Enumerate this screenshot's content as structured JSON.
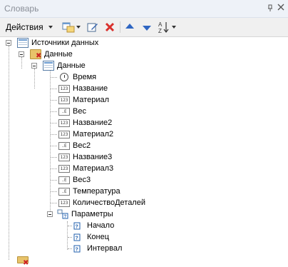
{
  "window": {
    "title": "Словарь",
    "pin_glyph": "ᵖ",
    "close_glyph": "✕"
  },
  "toolbar": {
    "actions_label": "Действия",
    "sort_glyph": "A↓Z"
  },
  "tree": {
    "root": "Источники данных",
    "datasource": "Данные",
    "table": "Данные",
    "fields": [
      {
        "label": "Время",
        "type": "time"
      },
      {
        "label": "Название",
        "type": "123"
      },
      {
        "label": "Материал",
        "type": "123"
      },
      {
        "label": "Вес",
        "type": ".E"
      },
      {
        "label": "Название2",
        "type": "123"
      },
      {
        "label": "Материал2",
        "type": "123"
      },
      {
        "label": "Вес2",
        "type": ".E"
      },
      {
        "label": "Название3",
        "type": "123"
      },
      {
        "label": "Материал3",
        "type": "123"
      },
      {
        "label": "Вес3",
        "type": ".E"
      },
      {
        "label": "Температура",
        "type": ".E"
      },
      {
        "label": "КоличествоДеталей",
        "type": "123"
      }
    ],
    "params_label": "Параметры",
    "params": [
      "Начало",
      "Конец",
      "Интервал"
    ]
  }
}
